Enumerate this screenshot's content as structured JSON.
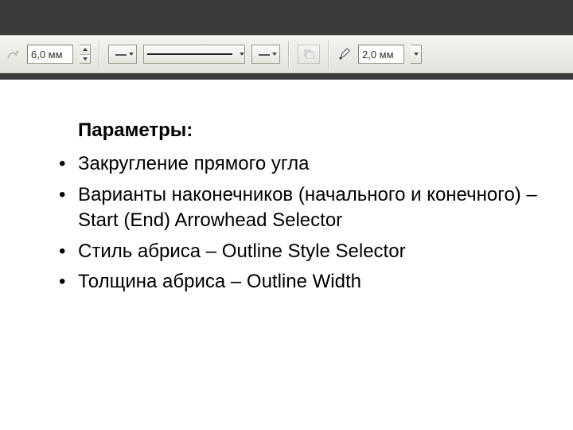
{
  "toolbar": {
    "freehand_smoothing": {
      "value": "6,0 мм"
    },
    "start_arrowhead": {
      "selected": "none"
    },
    "outline_style": {
      "selected": "solid"
    },
    "end_arrowhead": {
      "selected": "none"
    },
    "outline_width": {
      "value": "2,0 мм"
    }
  },
  "content": {
    "heading": "Параметры:",
    "items": [
      "Закругление прямого угла",
      "Варианты наконечников (начального и конечного) – Start (End) Arrowhead Selector",
      "Стиль абриса – Outline Style Selector",
      "Толщина абриса – Outline Width"
    ]
  }
}
